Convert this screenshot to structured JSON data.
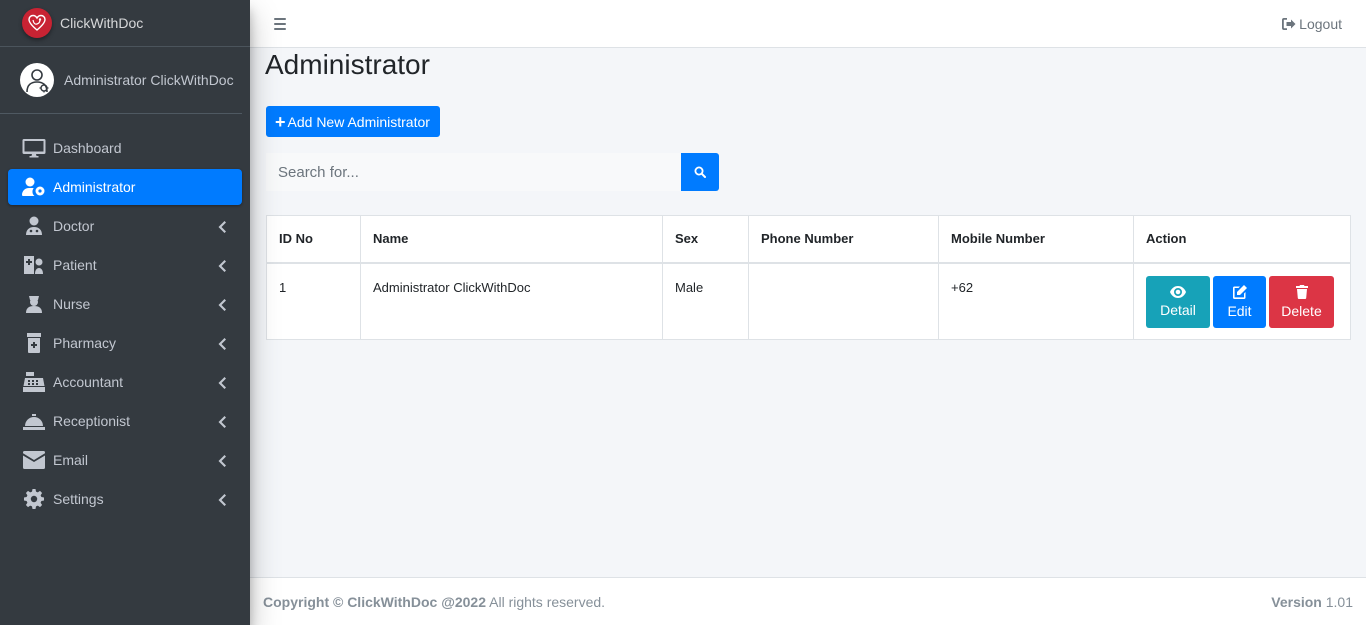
{
  "brand": {
    "name": "ClickWithDoc",
    "logo_icon": "heart-stethoscope-icon",
    "logo_color": "#c82333"
  },
  "user": {
    "name": "Administrator ClickWithDoc",
    "avatar_icon": "doctor-avatar-icon"
  },
  "sidebar": {
    "items": [
      {
        "label": "Dashboard",
        "icon": "desktop-icon",
        "active": false,
        "has_children": false
      },
      {
        "label": "Administrator",
        "icon": "user-cog-icon",
        "active": true,
        "has_children": false
      },
      {
        "label": "Doctor",
        "icon": "user-md-icon",
        "active": false,
        "has_children": true
      },
      {
        "label": "Patient",
        "icon": "hospital-user-icon",
        "active": false,
        "has_children": true
      },
      {
        "label": "Nurse",
        "icon": "user-nurse-icon",
        "active": false,
        "has_children": true
      },
      {
        "label": "Pharmacy",
        "icon": "prescription-bottle-icon",
        "active": false,
        "has_children": true
      },
      {
        "label": "Accountant",
        "icon": "cash-register-icon",
        "active": false,
        "has_children": true
      },
      {
        "label": "Receptionist",
        "icon": "concierge-bell-icon",
        "active": false,
        "has_children": true
      },
      {
        "label": "Email",
        "icon": "envelope-icon",
        "active": false,
        "has_children": true
      },
      {
        "label": "Settings",
        "icon": "gear-icon",
        "active": false,
        "has_children": true
      }
    ]
  },
  "topbar": {
    "logout_label": "Logout"
  },
  "main": {
    "title": "Administrator",
    "add_button_label": "Add New Administrator",
    "search": {
      "placeholder": "Search for..."
    },
    "table": {
      "headers": [
        "ID No",
        "Name",
        "Sex",
        "Phone Number",
        "Mobile Number",
        "Action"
      ],
      "rows": [
        {
          "id": "1",
          "name": "Administrator ClickWithDoc",
          "sex": "Male",
          "phone": "",
          "mobile": "+62"
        }
      ],
      "actions": {
        "detail": "Detail",
        "edit": "Edit",
        "delete": "Delete"
      }
    }
  },
  "footer": {
    "copyright_bold": "Copyright © ClickWithDoc @2022",
    "copyright_rest": "All rights reserved.",
    "version_label": "Version",
    "version_value": "1.01"
  },
  "colors": {
    "primary": "#007bff",
    "info": "#17a2b8",
    "danger": "#dc3545",
    "sidebar_bg": "#343a40"
  }
}
